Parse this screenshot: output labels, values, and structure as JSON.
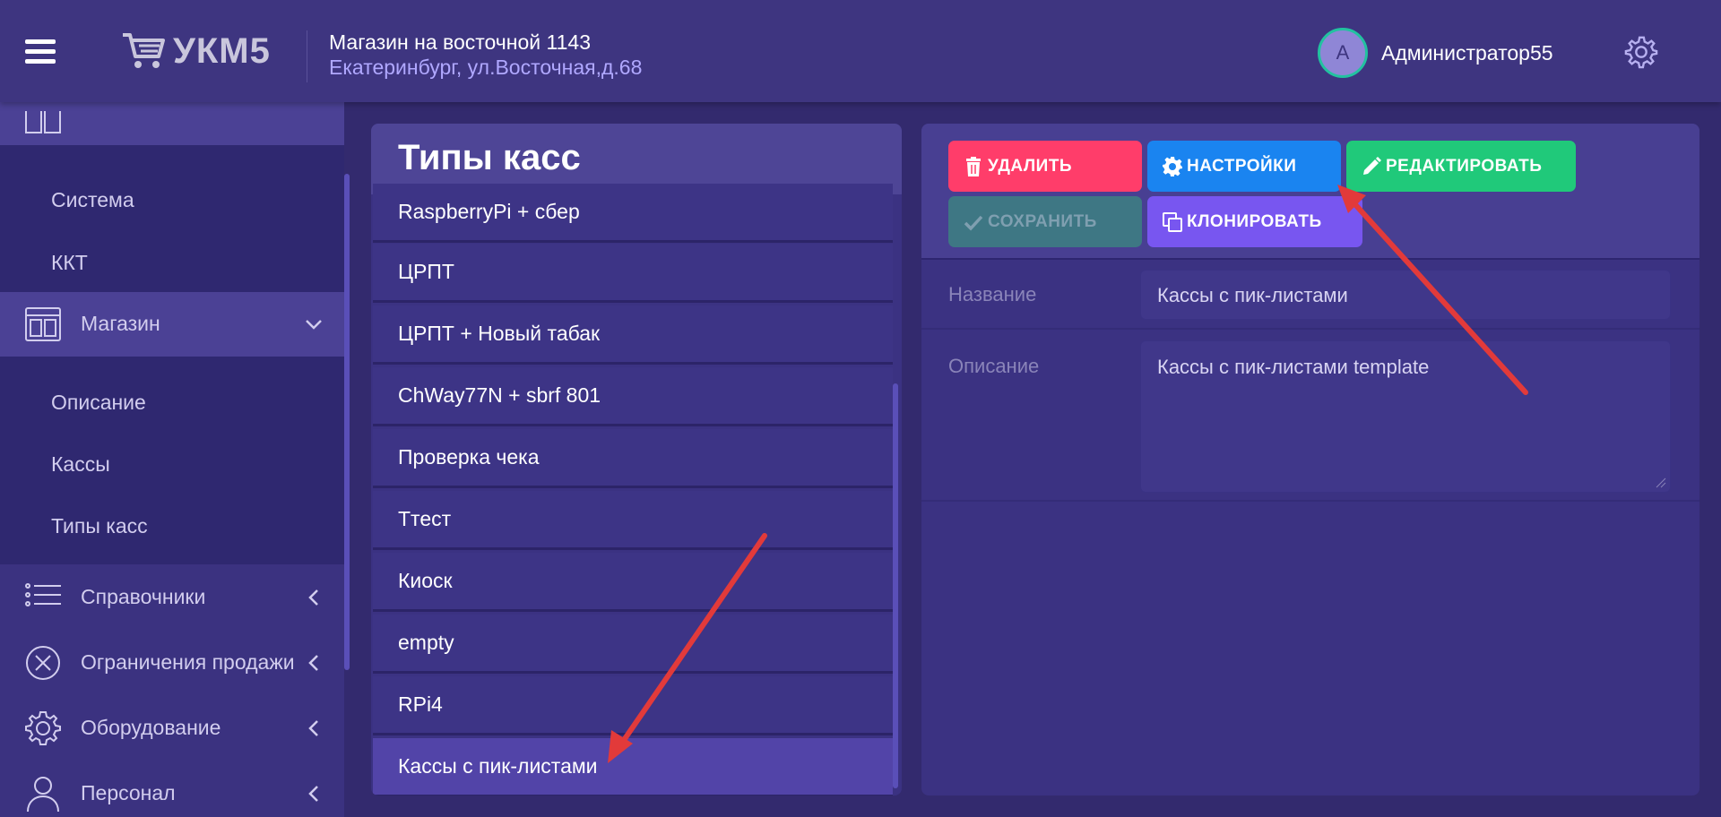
{
  "header": {
    "logo_text": "УКМ5",
    "store_name": "Магазин на восточной 1143",
    "store_address": "Екатеринбург, ул.Восточная,д.68",
    "avatar_letter": "А",
    "user_name": "Администратор55"
  },
  "sidebar": {
    "sub_items_system": [
      "Система",
      "ККТ"
    ],
    "store_item": {
      "label": "Магазин",
      "icon": "store-window-icon",
      "expanded": true
    },
    "sub_items_store": [
      "Описание",
      "Кассы",
      "Типы касс"
    ],
    "items": [
      {
        "label": "Справочники",
        "icon": "list-icon"
      },
      {
        "label": "Ограничения продажи",
        "icon": "x-circle-icon"
      },
      {
        "label": "Оборудование",
        "icon": "gear-icon"
      },
      {
        "label": "Персонал",
        "icon": "person-icon"
      }
    ]
  },
  "list": {
    "title": "Типы касс",
    "rows": [
      "RaspberryPi + сбер",
      "ЦРПТ",
      "ЦРПТ + Новый табак",
      "ChWay77N + sbrf 801",
      "Проверка чека",
      "Ттест",
      "Киоск",
      "empty",
      "RPi4",
      "Кассы с пик-листами"
    ],
    "selected_index": 9
  },
  "detail": {
    "buttons": {
      "delete": "УДАЛИТЬ",
      "settings": "НАСТРОЙКИ",
      "edit": "РЕДАКТИРОВАТЬ",
      "save": "СОХРАНИТЬ",
      "clone": "КЛОНИРОВАТЬ"
    },
    "fields": {
      "name_label": "Название",
      "name_value": "Кассы с пик-листами",
      "description_label": "Описание",
      "description_value": "Кассы с пик-листами template"
    }
  },
  "colors": {
    "background": "#332a6e",
    "header": "#3e3580",
    "delete": "#ff3d6a",
    "settings": "#1a84f0",
    "edit": "#20c97a",
    "save_disabled": "#3e7784",
    "clone": "#7856f0",
    "annotation_arrow": "#e23a3a"
  }
}
